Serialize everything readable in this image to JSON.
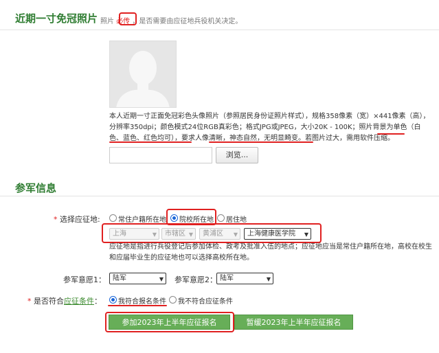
{
  "photo_section": {
    "title": "近期一寸免冠照片",
    "note_prefix": "照片",
    "required_tag": "必传",
    "note_suffix": "，是否需要由应征地兵役机关决定。",
    "description": "本人近期一寸正面免冠彩色头像照片（参照居民身份证照片样式），规格358像素（宽）×441像素（高），分辨率350dpi；颜色模式24位RGB真彩色；格式JPG或JPEG，大小20K - 100K；照片背景为单色（白色、蓝色、红色均可），要求人像清晰，神态自然，无明显畸变。若图片过大，需用软件压缩。",
    "file_value": "",
    "browse_label": "浏览..."
  },
  "enlist_section": {
    "title": "参军信息",
    "location_label": "选择应征地:",
    "location_options": [
      {
        "label": "常住户籍所在地",
        "selected": false
      },
      {
        "label": "院校所在地",
        "selected": true
      },
      {
        "label": "居住地",
        "selected": false
      }
    ],
    "province": "上海",
    "district_level": "市辖区",
    "district": "黄浦区",
    "school": "上海健康医学院",
    "hint": "应征地是指进行兵役登记后参加体检、政考及批准入伍的地点；应征地应当是常住户籍所在地，高校在校生和应届毕业生的应征地也可以选择高校所在地。",
    "wish1_label": "参军意愿1：",
    "wish1_value": "陆军",
    "wish2_label": "参军意愿2：",
    "wish2_value": "陆军",
    "eligible_label_prefix": "是否符合",
    "eligible_label_link": "应征条件",
    "eligible_label_suffix": "：",
    "eligible_options": [
      {
        "label": "我符合报名条件",
        "selected": true
      },
      {
        "label": "我不符合应征条件",
        "selected": false
      }
    ],
    "join_button": "参加2023年上半年应征报名",
    "defer_button": "暂缓2023年上半年应征报名"
  },
  "colors": {
    "accent_green": "#67ae58",
    "title_green": "#2f7d32",
    "annotation_red": "#e02020",
    "radio_blue": "#1a66d8"
  }
}
